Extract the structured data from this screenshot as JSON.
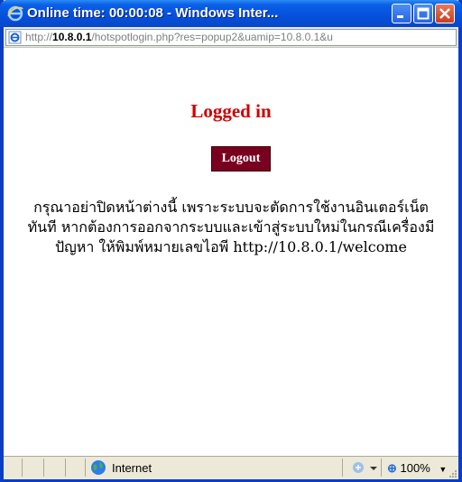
{
  "window": {
    "title": "Online time: 00:00:08 - Windows Inter..."
  },
  "address": {
    "prefix": "http://",
    "host": "10.8.0.1",
    "rest": "/hotspotlogin.php?res=popup2&uamip=10.8.0.1&u"
  },
  "page": {
    "heading": "Logged in",
    "logout_label": "Logout",
    "message": "กรุณาอย่าปิดหน้าต่างนี้ เพราะระบบจะตัดการใช้งานอินเตอร์เน็ตทันที หากต้องการออกจากระบบและเข้าสู่ระบบใหม่ในกรณีเครื่องมีปัญหา ให้พิมพ์หมายเลขไอพี http://10.8.0.1/welcome"
  },
  "status": {
    "zone": "Internet",
    "zoom": "100%"
  },
  "colors": {
    "heading": "#cc0000",
    "logout_bg": "#7a0020",
    "titlebar": "#0550dc"
  }
}
